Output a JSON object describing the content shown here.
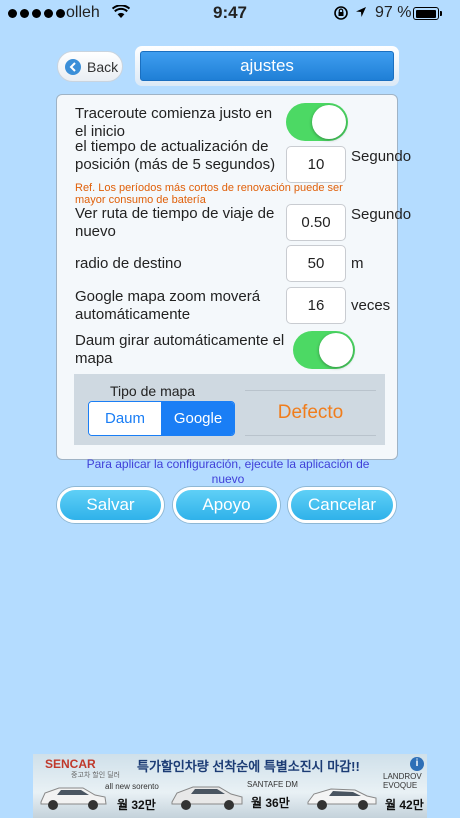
{
  "status_bar": {
    "carrier": "olleh",
    "time": "9:47",
    "battery_percent": "97 %",
    "battery_level": 0.97
  },
  "header": {
    "back_label": "Back",
    "title": "ajustes"
  },
  "settings": {
    "traceroute_label": "Traceroute comienza justo en el inicio",
    "traceroute_on": true,
    "position_update_label": "el tiempo de actualización de posición (más de 5 segundos)",
    "position_update_value": "10",
    "position_update_unit": "Segundo",
    "warning_text": "Ref. Los períodos más cortos de renovación puede ser mayor consumo de batería",
    "travel_time_label": "Ver ruta de tiempo de viaje de nuevo",
    "travel_time_value": "0.50",
    "travel_time_unit": "Segundo",
    "radius_label": "radio de destino",
    "radius_value": "50",
    "radius_unit": "m",
    "zoom_label": "Google mapa zoom moverá automáticamente",
    "zoom_value": "16",
    "zoom_unit": "veces",
    "rotate_label": "Daum girar automáticamente el mapa",
    "rotate_on": true
  },
  "map_type": {
    "label": "Tipo de mapa",
    "options": [
      "Daum",
      "Google"
    ],
    "selected": "Google",
    "default_label": "Defecto"
  },
  "note": "Para aplicar la configuración, ejecute la aplicación de nuevo",
  "actions": {
    "save": "Salvar",
    "support": "Apoyo",
    "cancel": "Cancelar"
  },
  "ad": {
    "brand": "SENCAR",
    "brand_sub": "중고차 할인 딜러",
    "headline": "특가할인차량 선착순에 특별소진시 마감!!",
    "info_icon": "i",
    "car1_name": "all new sorento",
    "car1_price": "월 32만",
    "car2_name": "SANTAFE DM",
    "car2_price": "월 36만",
    "car3_name": "LANDROV EVOQUE",
    "car3_price": "월 42만"
  },
  "colors": {
    "background": "#b4dcff",
    "toggle_on": "#4cd964",
    "segment_blue": "#1a7ef5",
    "default_orange": "#f07d1c",
    "note_blue": "#3f3fd8",
    "button_cyan": "#2fb2ea"
  }
}
